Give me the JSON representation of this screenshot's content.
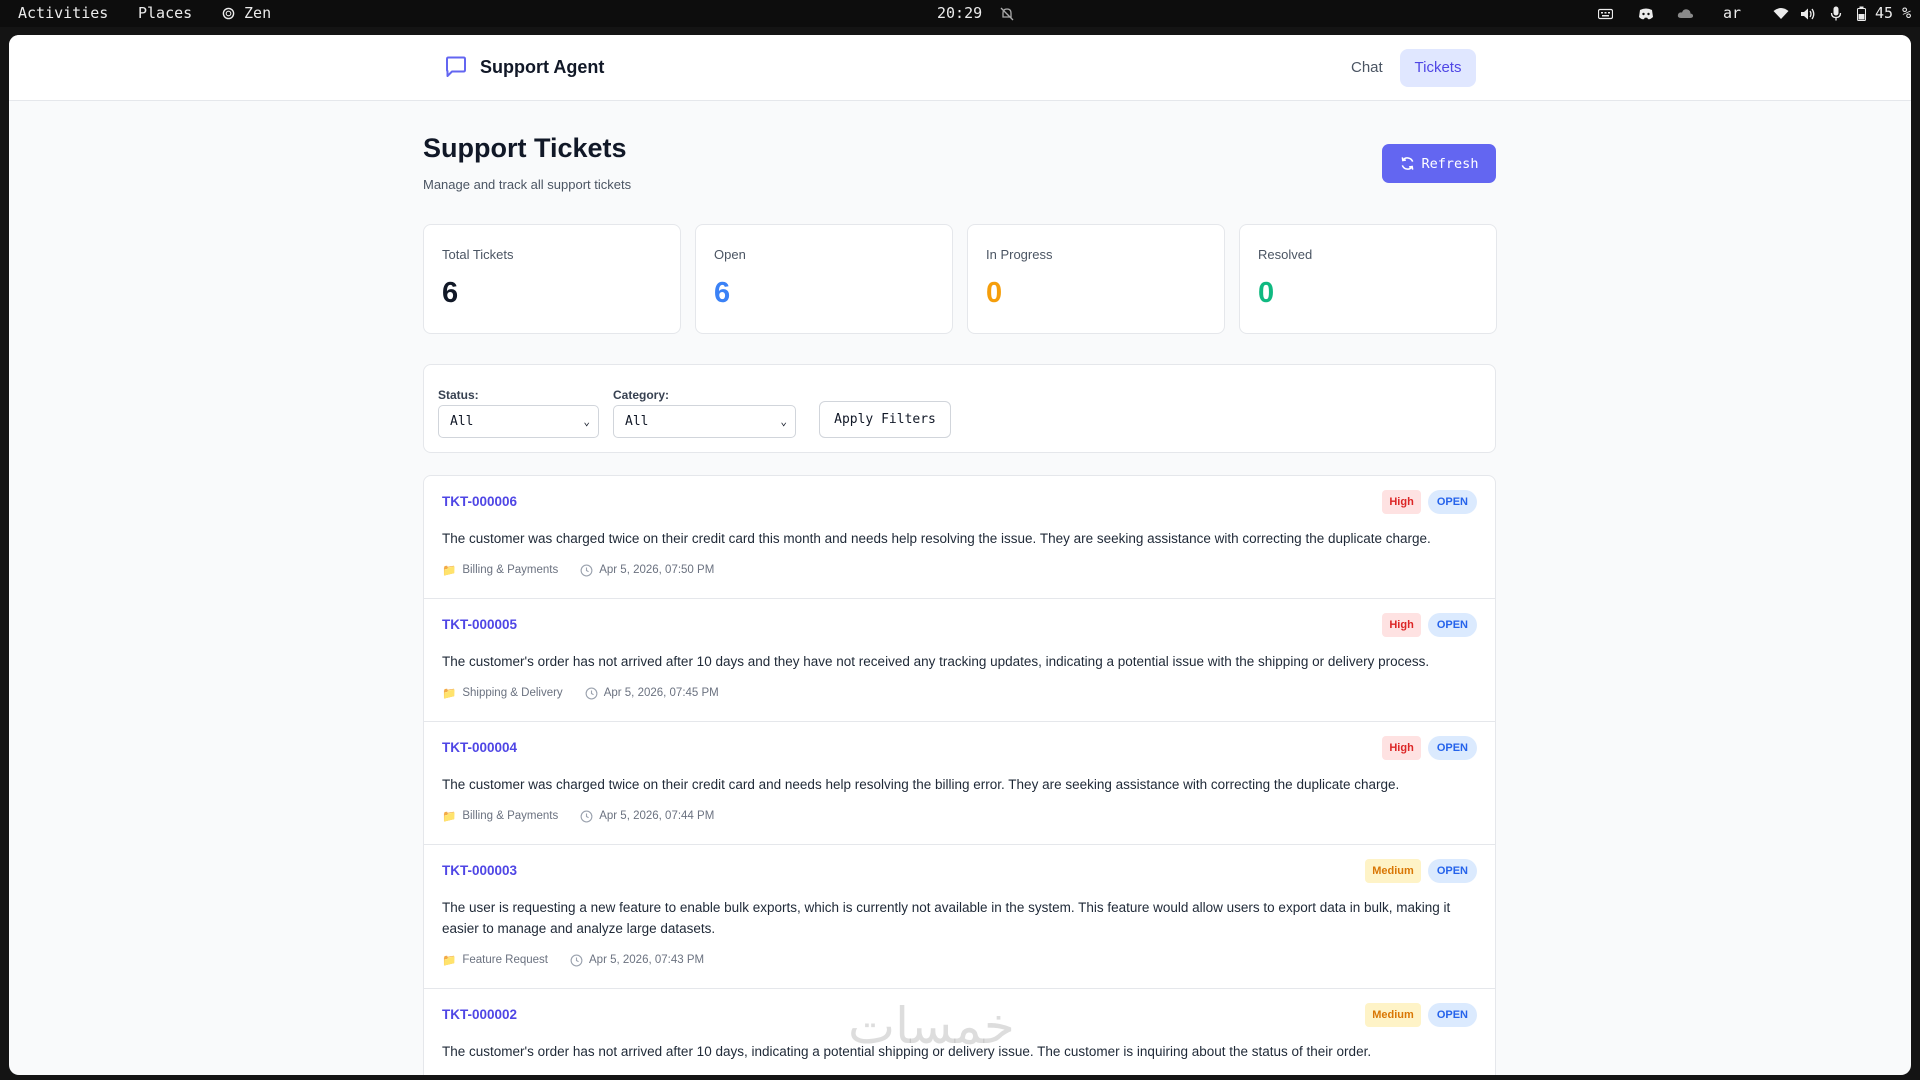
{
  "system_bar": {
    "activities": "Activities",
    "places": "Places",
    "app_name": "Zen",
    "clock": "20:29",
    "keyboard_layout": "ar",
    "battery": "45 %"
  },
  "app": {
    "title": "Support Agent",
    "nav": {
      "chat": "Chat",
      "tickets": "Tickets"
    }
  },
  "page": {
    "title": "Support Tickets",
    "subtitle": "Manage and track all support tickets",
    "refresh_label": "Refresh"
  },
  "stats": [
    {
      "label": "Total Tickets",
      "value": "6",
      "color": "#111827"
    },
    {
      "label": "Open",
      "value": "6",
      "color": "#3b82f6"
    },
    {
      "label": "In Progress",
      "value": "0",
      "color": "#f59e0b"
    },
    {
      "label": "Resolved",
      "value": "0",
      "color": "#10b981"
    }
  ],
  "filters": {
    "status_label": "Status:",
    "status_value": "All",
    "category_label": "Category:",
    "category_value": "All",
    "apply_label": "Apply Filters"
  },
  "colors": {
    "accent": "#6366f1",
    "high_bg": "#fee2e2",
    "high_fg": "#dc2626",
    "medium_bg": "#fef3c7",
    "medium_fg": "#d97706",
    "open_bg": "#dbeafe",
    "open_fg": "#2563eb"
  },
  "tickets": [
    {
      "id": "TKT-000006",
      "priority": "High",
      "status": "OPEN",
      "description": "The customer was charged twice on their credit card this month and needs help resolving the issue. They are seeking assistance with correcting the duplicate charge.",
      "category": "Billing & Payments",
      "date": "Apr 5, 2026, 07:50 PM"
    },
    {
      "id": "TKT-000005",
      "priority": "High",
      "status": "OPEN",
      "description": "The customer's order has not arrived after 10 days and they have not received any tracking updates, indicating a potential issue with the shipping or delivery process.",
      "category": "Shipping & Delivery",
      "date": "Apr 5, 2026, 07:45 PM"
    },
    {
      "id": "TKT-000004",
      "priority": "High",
      "status": "OPEN",
      "description": "The customer was charged twice on their credit card and needs help resolving the billing error. They are seeking assistance with correcting the duplicate charge.",
      "category": "Billing & Payments",
      "date": "Apr 5, 2026, 07:44 PM"
    },
    {
      "id": "TKT-000003",
      "priority": "Medium",
      "status": "OPEN",
      "description": "The user is requesting a new feature to enable bulk exports, which is currently not available in the system. This feature would allow users to export data in bulk, making it easier to manage and analyze large datasets.",
      "category": "Feature Request",
      "date": "Apr 5, 2026, 07:43 PM"
    },
    {
      "id": "TKT-000002",
      "priority": "Medium",
      "status": "OPEN",
      "description": "The customer's order has not arrived after 10 days, indicating a potential shipping or delivery issue. The customer is inquiring about the status of their order.",
      "category": "",
      "date": ""
    }
  ],
  "watermark": "خمسات"
}
